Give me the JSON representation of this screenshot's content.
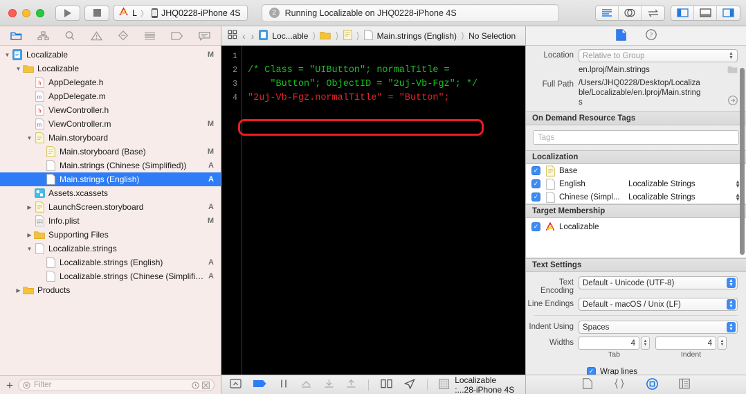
{
  "toolbar": {
    "run_button": "Run",
    "stop_button": "Stop",
    "scheme_name": "L",
    "scheme_separator": "〉",
    "device_name": "JHQ0228-iPhone 4S",
    "status_badge": "2",
    "status_text": "Running Localizable on JHQ0228-iPhone 4S",
    "editor_standard": "Standard Editor",
    "editor_assistant": "Assistant Editor",
    "editor_version": "Version Editor",
    "view_navigator": "Hide Navigator",
    "view_debug": "Hide Debug Area",
    "view_utilities": "Hide Utilities"
  },
  "navigator": {
    "tabs": [
      {
        "name": "project-navigator",
        "active": true
      },
      {
        "name": "symbol-navigator",
        "active": false
      },
      {
        "name": "find-navigator",
        "active": false
      },
      {
        "name": "issue-navigator",
        "active": false
      },
      {
        "name": "test-navigator",
        "active": false
      },
      {
        "name": "debug-navigator",
        "active": false
      },
      {
        "name": "breakpoint-navigator",
        "active": false
      },
      {
        "name": "report-navigator",
        "active": false
      }
    ],
    "items": [
      {
        "label": "Localizable",
        "indent": 0,
        "twisty": "down",
        "icon": "project",
        "status": "M",
        "selected": false
      },
      {
        "label": "Localizable",
        "indent": 1,
        "twisty": "down",
        "icon": "folder",
        "status": "",
        "selected": false
      },
      {
        "label": "AppDelegate.h",
        "indent": 2,
        "twisty": "",
        "icon": "h",
        "status": "",
        "selected": false
      },
      {
        "label": "AppDelegate.m",
        "indent": 2,
        "twisty": "",
        "icon": "m",
        "status": "",
        "selected": false
      },
      {
        "label": "ViewController.h",
        "indent": 2,
        "twisty": "",
        "icon": "h",
        "status": "",
        "selected": false
      },
      {
        "label": "ViewController.m",
        "indent": 2,
        "twisty": "",
        "icon": "m",
        "status": "M",
        "selected": false
      },
      {
        "label": "Main.storyboard",
        "indent": 2,
        "twisty": "down",
        "icon": "storyboard",
        "status": "",
        "selected": false
      },
      {
        "label": "Main.storyboard (Base)",
        "indent": 3,
        "twisty": "",
        "icon": "storyboard",
        "status": "M",
        "selected": false
      },
      {
        "label": "Main.strings (Chinese (Simplified))",
        "indent": 3,
        "twisty": "",
        "icon": "file",
        "status": "A",
        "selected": false
      },
      {
        "label": "Main.strings (English)",
        "indent": 3,
        "twisty": "",
        "icon": "file",
        "status": "A",
        "selected": true
      },
      {
        "label": "Assets.xcassets",
        "indent": 2,
        "twisty": "",
        "icon": "assets",
        "status": "",
        "selected": false
      },
      {
        "label": "LaunchScreen.storyboard",
        "indent": 2,
        "twisty": "right",
        "icon": "storyboard",
        "status": "A",
        "selected": false
      },
      {
        "label": "Info.plist",
        "indent": 2,
        "twisty": "",
        "icon": "plist",
        "status": "M",
        "selected": false
      },
      {
        "label": "Supporting Files",
        "indent": 2,
        "twisty": "right",
        "icon": "folder",
        "status": "",
        "selected": false
      },
      {
        "label": "Localizable.strings",
        "indent": 2,
        "twisty": "down",
        "icon": "file",
        "status": "",
        "selected": false
      },
      {
        "label": "Localizable.strings (English)",
        "indent": 3,
        "twisty": "",
        "icon": "file",
        "status": "A",
        "selected": false
      },
      {
        "label": "Localizable.strings (Chinese (Simplified))",
        "indent": 3,
        "twisty": "",
        "icon": "file",
        "status": "A",
        "selected": false
      },
      {
        "label": "Products",
        "indent": 1,
        "twisty": "right",
        "icon": "folder",
        "status": "",
        "selected": false
      }
    ],
    "filter_placeholder": "Filter",
    "add_button": "+"
  },
  "editor": {
    "jumpbar": {
      "project": "Loc...able",
      "file": "Main.strings (English)",
      "selection": "No Selection"
    },
    "line_numbers": [
      "1",
      "2",
      "3",
      "4"
    ],
    "code_lines": [
      "/* Class = \"UIButton\"; normalTitle =",
      "    \"Button\"; ObjectID = \"2uj-Vb-Fgz\"; */",
      "\"2uj-Vb-Fgz.normalTitle\" = \"Button\";"
    ],
    "comment_color": "#17c21c",
    "string_color": "#e8232a",
    "annotation_color": "#ee1c20",
    "background": "#000000"
  },
  "debugbar": {
    "target_label": "Localizable :...28-iPhone 4S",
    "buttons": [
      "hide-debug-area",
      "breakpoints",
      "pause",
      "step-over",
      "step-into",
      "step-out",
      "view-hierarchy",
      "location-simulate"
    ]
  },
  "inspector": {
    "tabs": [
      {
        "name": "file-inspector",
        "active": true
      },
      {
        "name": "quick-help-inspector",
        "active": false
      }
    ],
    "file": {
      "location_label": "Location",
      "location_value": "Relative to Group",
      "filename": "en.lproj/Main.strings",
      "fullpath_label": "Full Path",
      "fullpath_value": "/Users/JHQ0228/Desktop/Localizable/Localizable/en.lproj/Main.strings"
    },
    "ondemand": {
      "title": "On Demand Resource Tags",
      "tags_placeholder": "Tags"
    },
    "localization": {
      "title": "Localization",
      "rows": [
        {
          "checked": true,
          "name": "Base",
          "kind": "",
          "icon": "storyboard",
          "has_popup": false
        },
        {
          "checked": true,
          "name": "English",
          "kind": "Localizable Strings",
          "icon": "file",
          "has_popup": true
        },
        {
          "checked": true,
          "name": "Chinese (Simpl...",
          "kind": "Localizable Strings",
          "icon": "file",
          "has_popup": true
        }
      ]
    },
    "target_membership": {
      "title": "Target Membership",
      "rows": [
        {
          "checked": true,
          "name": "Localizable",
          "icon": "app"
        }
      ]
    },
    "text_settings": {
      "title": "Text Settings",
      "encoding_label": "Text Encoding",
      "encoding_value": "Default - Unicode (UTF-8)",
      "line_endings_label": "Line Endings",
      "line_endings_value": "Default - macOS / Unix (LF)",
      "indent_label": "Indent Using",
      "indent_value": "Spaces",
      "widths_label": "Widths",
      "tab_width": "4",
      "indent_width": "4",
      "tab_sublabel": "Tab",
      "indent_sublabel": "Indent",
      "wrap_lines_label": "Wrap lines",
      "wrap_lines_checked": true
    },
    "bottom_tabs": [
      {
        "name": "file-template-library",
        "active": false
      },
      {
        "name": "code-snippet-library",
        "active": false
      },
      {
        "name": "media-library",
        "active": true
      },
      {
        "name": "object-library",
        "active": false
      }
    ]
  }
}
